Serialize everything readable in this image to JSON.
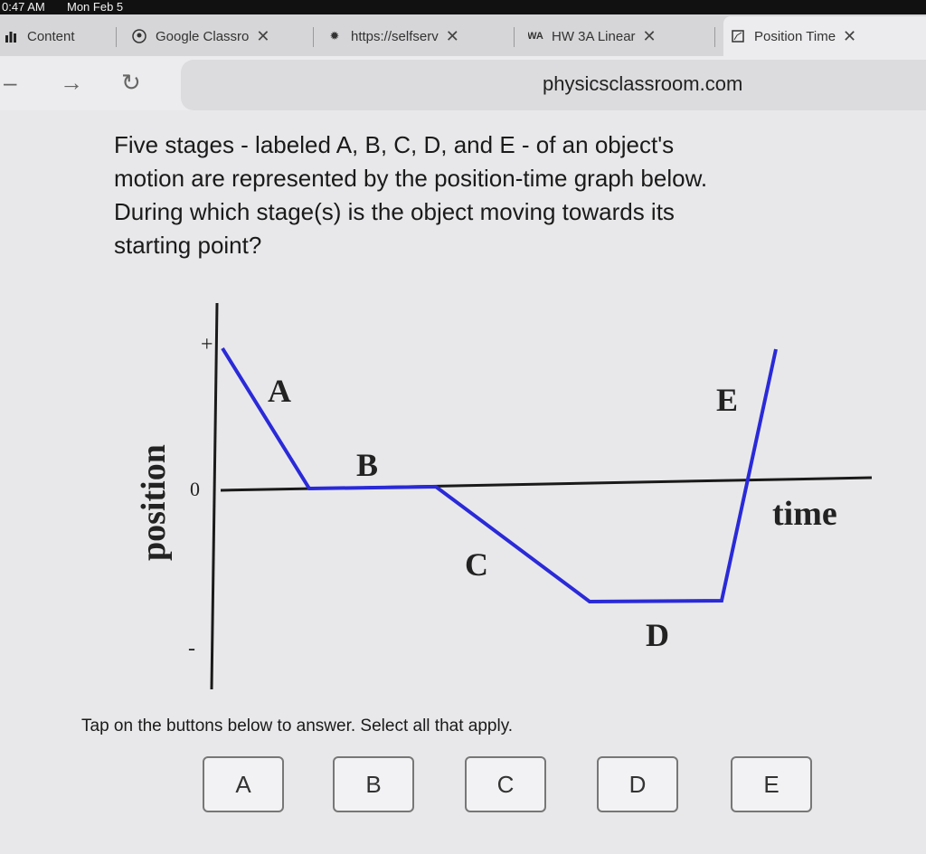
{
  "status": {
    "time": "0:47 AM",
    "date": "Mon Feb 5"
  },
  "tabs": [
    {
      "label": "Content",
      "icon": "chart-bar-icon"
    },
    {
      "label": "Google Classro",
      "icon": "google-classroom-icon"
    },
    {
      "label": "https://selfserv",
      "icon": "gear-icon"
    },
    {
      "label": "HW 3A Linear",
      "icon": "webassign-icon"
    },
    {
      "label": "Position Time",
      "icon": "page-icon"
    }
  ],
  "address": {
    "url": "physicsclassroom.com"
  },
  "question": {
    "lines": [
      "Five stages - labeled A, B, C, D, and E - of an object's",
      "motion are represented by the position-time graph below.",
      "During which stage(s) is the object moving towards its",
      "starting point?"
    ]
  },
  "chart_data": {
    "type": "line",
    "xlabel": "time",
    "ylabel": "position",
    "y_tick_labels": [
      "+",
      "0",
      "-"
    ],
    "segment_labels": [
      "A",
      "B",
      "C",
      "D",
      "E"
    ],
    "line_color": "#2a2ad8",
    "axis_color": "#1a1a1a"
  },
  "instructions": "Tap on the buttons below to answer. Select all that apply.",
  "answers": [
    "A",
    "B",
    "C",
    "D",
    "E"
  ]
}
